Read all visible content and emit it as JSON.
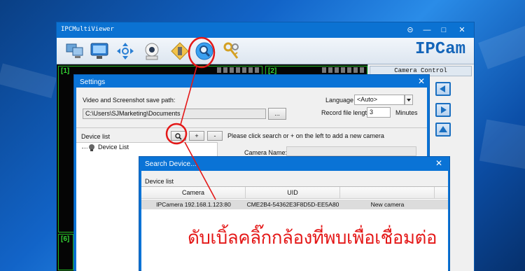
{
  "main_window": {
    "title": "IPCMultiViewer",
    "controls": [
      "⊝",
      "—",
      "□",
      "✕"
    ],
    "brand": "IPCam",
    "toolbar_icons": [
      "computers-icon",
      "monitor-icon",
      "ptz-arrows-icon",
      "camera-icon",
      "settings-tools-icon",
      "search-device-icon",
      "keys-icon"
    ]
  },
  "video_grid": {
    "cells": [
      "[1]",
      "[2]",
      "[6]"
    ]
  },
  "control_panel": {
    "header": "Camera Control"
  },
  "settings": {
    "title": "Settings",
    "close": "✕",
    "save_path_label": "Video and Screenshot save path:",
    "save_path_value": "C:\\Users\\SJMarketing\\Documents",
    "browse_label": "...",
    "language_label": "Language",
    "language_value": "<Auto>",
    "record_length_label": "Record file length",
    "record_length_value": "3",
    "minutes_label": "Minutes",
    "device_list_label": "Device list",
    "add_label": "+",
    "remove_label": "-",
    "hint": "Please click search or + on the left to add a new camera",
    "tree_item": "Device List",
    "camera_name_label": "Camera Name:"
  },
  "search_dialog": {
    "title": "Search Device...",
    "close": "✕",
    "device_list_label": "Device list",
    "columns": [
      "Camera",
      "UID",
      ""
    ],
    "rows": [
      [
        "IPCamera 192.168.1.123:80",
        "CME2B4-54362E3F8D5D-EE5A80",
        "New camera"
      ]
    ]
  },
  "annotation": {
    "instruction": "ดับเบิ้ลคลิ๊กกล้องที่พบเพื่อเชื่อมต่อ",
    "color": "#e41818"
  },
  "colors": {
    "accent_blue": "#0a73d6",
    "grid_green": "#1fb51f",
    "brand_blue": "#1465b9"
  }
}
